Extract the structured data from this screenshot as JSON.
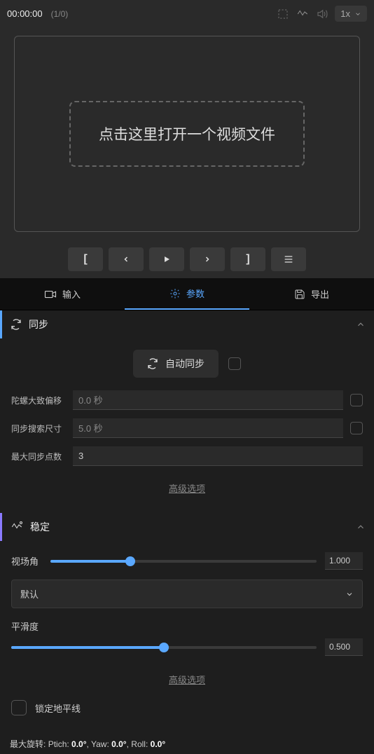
{
  "topbar": {
    "timecode": "00:00:00",
    "frame_count": "(1/0)",
    "speed": "1x"
  },
  "video": {
    "drop_hint": "点击这里打开一个视频文件"
  },
  "tabs": {
    "input": "输入",
    "params": "参数",
    "export": "导出"
  },
  "sync": {
    "title": "同步",
    "auto_btn": "自动同步",
    "offset_label": "陀螺大致偏移",
    "offset_val": "0.0 秒",
    "search_label": "同步搜索尺寸",
    "search_val": "5.0 秒",
    "maxpts_label": "最大同步点数",
    "maxpts_val": "3",
    "advanced": "高级选项"
  },
  "stab": {
    "title": "稳定",
    "fov_label": "视场角",
    "fov_val": "1.000",
    "method": "默认",
    "smooth_label": "平滑度",
    "smooth_val": "0.500",
    "advanced": "高级选项",
    "lock_horizon": "锁定地平线",
    "max_rot_label": "最大旋转:",
    "pitch_label": "Ptich:",
    "pitch_val": "0.0°",
    "yaw_label": "Yaw:",
    "yaw_val": "0.0°",
    "roll_label": "Roll:",
    "roll_val": "0.0°"
  }
}
